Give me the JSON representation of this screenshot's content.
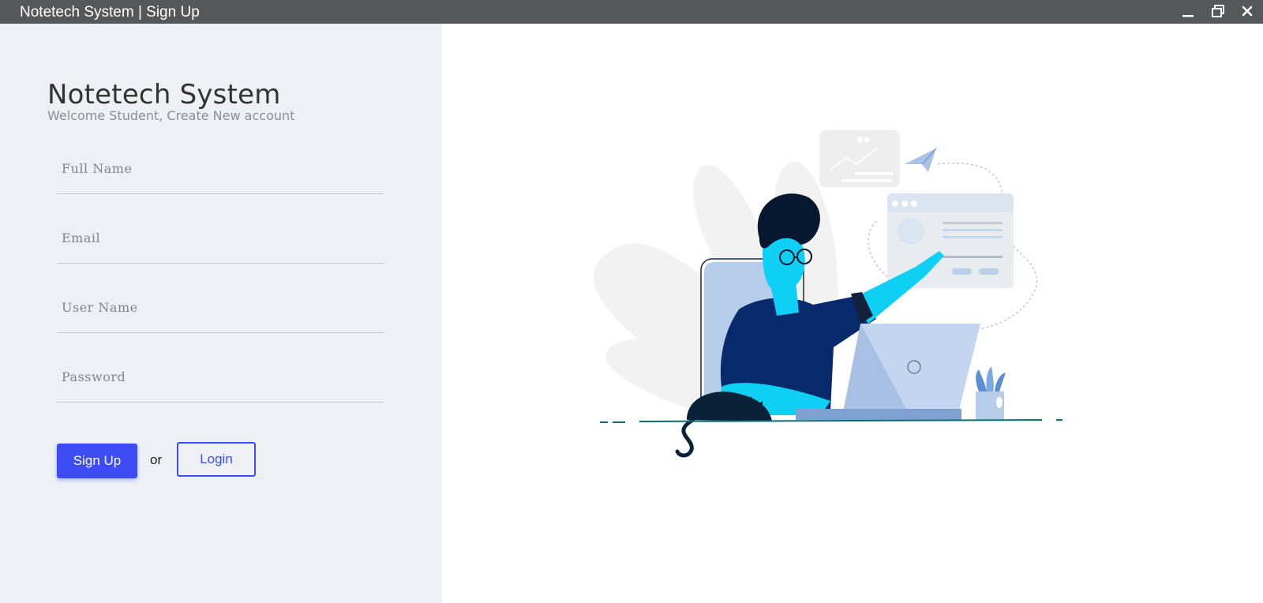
{
  "window": {
    "title": "Notetech System | Sign Up"
  },
  "form": {
    "app_title": "Notetech System",
    "subtitle": "Welcome Student, Create New account",
    "fields": {
      "full_name_placeholder": "Full Name",
      "email_placeholder": "Email",
      "username_placeholder": "User Name",
      "password_placeholder": "Password"
    },
    "signup_label": "Sign Up",
    "or_label": "or",
    "login_label": "Login"
  },
  "icons": {
    "minimize": "minimize-icon",
    "maximize": "restore-icon",
    "close": "close-icon"
  },
  "colors": {
    "accent": "#3d4cf5",
    "titlebar": "#55585b",
    "panel": "#edf1f6"
  }
}
